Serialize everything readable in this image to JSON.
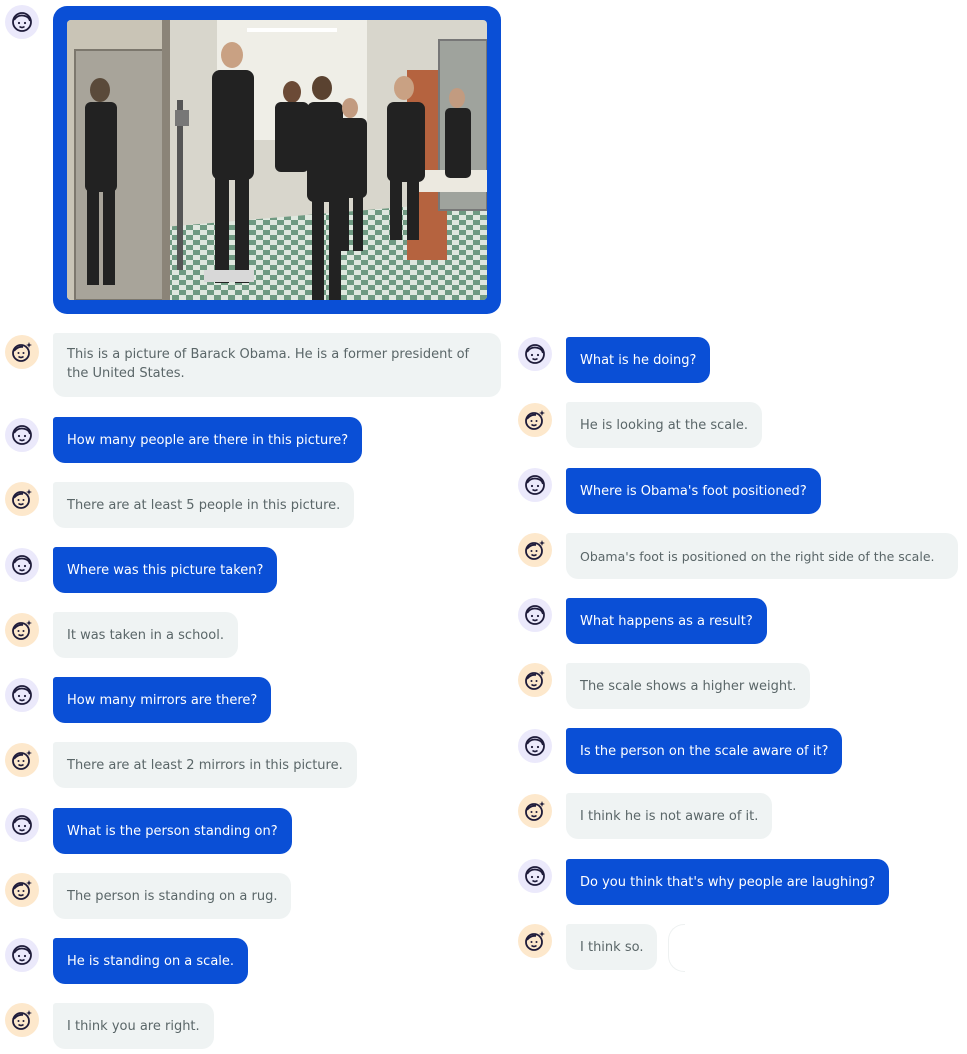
{
  "conversation": {
    "image_alt": "Photo of Barack Obama pressing on a scale with his foot in a school hallway",
    "left": [
      {
        "role": "user",
        "type": "image"
      },
      {
        "role": "bot",
        "text": "This is a picture of Barack Obama. He is a former president of the United States."
      },
      {
        "role": "user",
        "text": "How many people are there in this picture?"
      },
      {
        "role": "bot",
        "text": "There are at least 5 people in this picture."
      },
      {
        "role": "user",
        "text": "Where was this picture taken?"
      },
      {
        "role": "bot",
        "text": "It was taken in a school."
      },
      {
        "role": "user",
        "text": "How many mirrors are there?"
      },
      {
        "role": "bot",
        "text": "There are at least 2 mirrors in this picture."
      },
      {
        "role": "user",
        "text": "What is the person standing on?"
      },
      {
        "role": "bot",
        "text": "The person is standing on a rug."
      },
      {
        "role": "user",
        "text": "He is standing on a scale."
      },
      {
        "role": "bot",
        "text": "I think you are right."
      }
    ],
    "right": [
      {
        "role": "user",
        "text": "What is he doing?"
      },
      {
        "role": "bot",
        "text": "He is looking at the scale."
      },
      {
        "role": "user",
        "text": "Where is Obama's foot positioned?"
      },
      {
        "role": "bot",
        "text": "Obama's foot is positioned on the right side of the scale."
      },
      {
        "role": "user",
        "text": "What happens as a result?"
      },
      {
        "role": "bot",
        "text": "The scale shows a higher weight."
      },
      {
        "role": "user",
        "text": "Is the person on the scale aware of it?"
      },
      {
        "role": "bot",
        "text": "I think he is not aware of it."
      },
      {
        "role": "user",
        "text": "Do you think that's why people are laughing?"
      },
      {
        "role": "bot",
        "text": "I think so."
      }
    ]
  },
  "icons": {
    "user": "user-face-icon",
    "bot": "bot-face-sparkle-icon"
  },
  "colors": {
    "user_bubble": "#0a4fd6",
    "bot_bubble": "#eff3f3",
    "user_avatar_bg": "#ebe9fb",
    "bot_avatar_bg": "#fde8cc"
  }
}
